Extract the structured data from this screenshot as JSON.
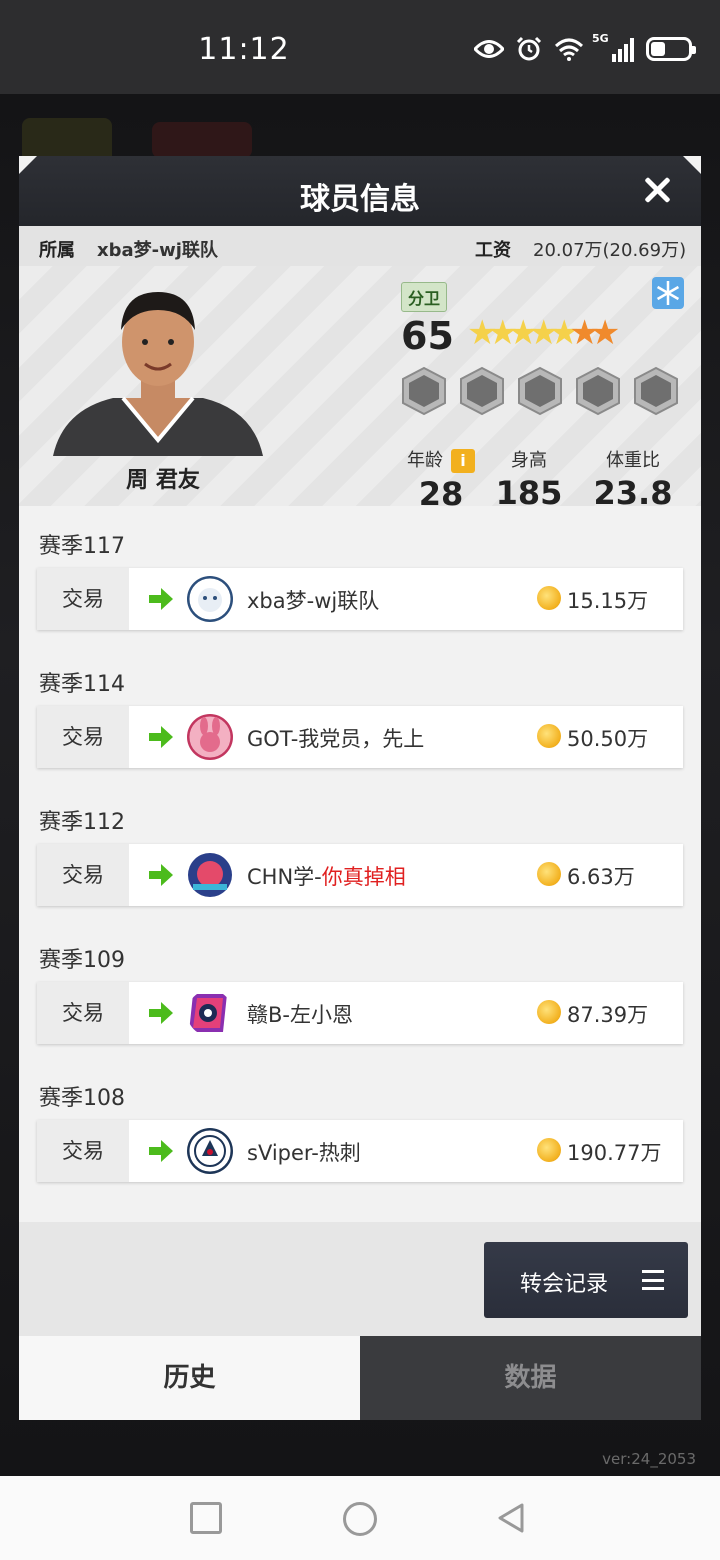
{
  "status_bar": {
    "time": "11:12",
    "network": "5G"
  },
  "modal": {
    "title": "球员信息",
    "team_label": "所属",
    "team_value": "xba梦-wj联队",
    "salary_label": "工资",
    "salary_value": "20.07万(20.69万)"
  },
  "player": {
    "name": "周 君友",
    "position": "分卫",
    "rating": "65",
    "star_count": 7,
    "stats": [
      {
        "label": "年龄",
        "value": "28"
      },
      {
        "label": "身高",
        "value": "185"
      },
      {
        "label": "体重比",
        "value": "23.8"
      }
    ],
    "info_badge": "i"
  },
  "history": [
    {
      "season": "赛季117",
      "type": "交易",
      "team": "xba梦-wj联队",
      "team_highlight": "",
      "fee": "15.15万",
      "logo_color": "#2c4f7c"
    },
    {
      "season": "赛季114",
      "type": "交易",
      "team": "GOT-我党员，先上",
      "team_highlight": "",
      "fee": "50.50万",
      "logo_color": "#e36b8c"
    },
    {
      "season": "赛季112",
      "type": "交易",
      "team": "CHN学-",
      "team_highlight": "你真掉相",
      "fee": "6.63万",
      "logo_color": "#2a3f8a"
    },
    {
      "season": "赛季109",
      "type": "交易",
      "team": "赣B-左小恩",
      "team_highlight": "",
      "fee": "87.39万",
      "logo_color": "#8a2fb0"
    },
    {
      "season": "赛季108",
      "type": "交易",
      "team": "sViper-热刺",
      "team_highlight": "",
      "fee": "190.77万",
      "logo_color": "#1d3557"
    }
  ],
  "transfer_button": "转会记录",
  "tabs": {
    "history": "历史",
    "data": "数据"
  },
  "version": "ver:24_2053",
  "colors": {
    "highlight": "#e02020",
    "arrow": "#4cbb1c",
    "coin": "#f2b01e"
  }
}
